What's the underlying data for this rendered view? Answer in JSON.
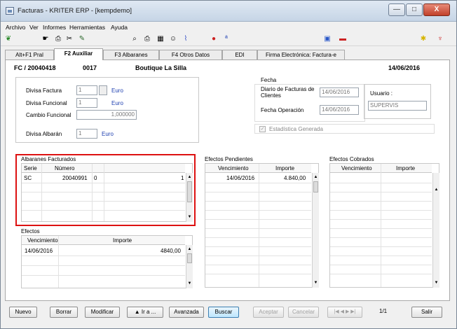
{
  "window": {
    "title": "Facturas - KRITER ERP - [kempdemo]",
    "minimize": "—",
    "maximize": "□",
    "close": "X"
  },
  "menu": [
    "Archivo",
    "Ver",
    "Informes",
    "Herramientas",
    "Ayuda"
  ],
  "tabs": [
    "Alt+F1 Pral",
    "F2 Auxiliar",
    "F3 Albaranes",
    "F4 Otros Datos",
    "EDI",
    "Firma Electrónica: Factura-e"
  ],
  "header": {
    "doc_number": "FC / 20040418",
    "code": "0017",
    "client": "Boutique La Silla",
    "date": "14/06/2016"
  },
  "currency": {
    "divisa_factura_label": "Divisa Factura",
    "divisa_factura_value": "1",
    "divisa_factura_name": "Euro",
    "divisa_funcional_label": "Divisa Funcional",
    "divisa_funcional_value": "1",
    "divisa_funcional_name": "Euro",
    "cambio_label": "Cambio Funcional",
    "cambio_value": "1,000000",
    "divisa_albaran_label": "Divisa Albarán",
    "divisa_albaran_value": "1",
    "divisa_albaran_name": "Euro"
  },
  "fecha": {
    "group_label": "Fecha",
    "diario_label": "Diario de Facturas de Clientes",
    "diario_value": "14/06/2016",
    "operacion_label": "Fecha Operación",
    "operacion_value": "14/06/2016",
    "usuario_label": "Usuario :",
    "usuario_value": "SUPERVIS",
    "estadistica_label": "Estadística Generada"
  },
  "albaranes": {
    "title": "Albaranes Facturados",
    "columns": [
      "Serie",
      "Número"
    ],
    "rows": [
      {
        "serie": "SC",
        "numero": "20040991",
        "c3": "0",
        "c4": "1"
      }
    ]
  },
  "efectos": {
    "title": "Efectos",
    "columns": [
      "Vencimiento",
      "Importe"
    ],
    "rows": [
      {
        "vencimiento": "14/06/2016",
        "importe": "4840,00"
      }
    ]
  },
  "pendientes": {
    "title": "Efectos Pendientes",
    "columns": [
      "Vencimiento",
      "Importe"
    ],
    "rows": [
      {
        "vencimiento": "14/06/2016",
        "importe": "4.840,00"
      }
    ]
  },
  "cobrados": {
    "title": "Efectos Cobrados",
    "columns": [
      "Vencimiento",
      "Importe"
    ]
  },
  "buttons": {
    "nuevo": "Nuevo",
    "borrar": "Borrar",
    "modificar": "Modificar",
    "ira": "▲ Ir a ...",
    "avanzada": "Avanzada",
    "buscar": "Buscar",
    "aceptar": "Aceptar",
    "cancelar": "Cancelar",
    "nav": "|◀ ◀ ▶ ▶|",
    "pager": "1/1",
    "salir": "Salir"
  }
}
